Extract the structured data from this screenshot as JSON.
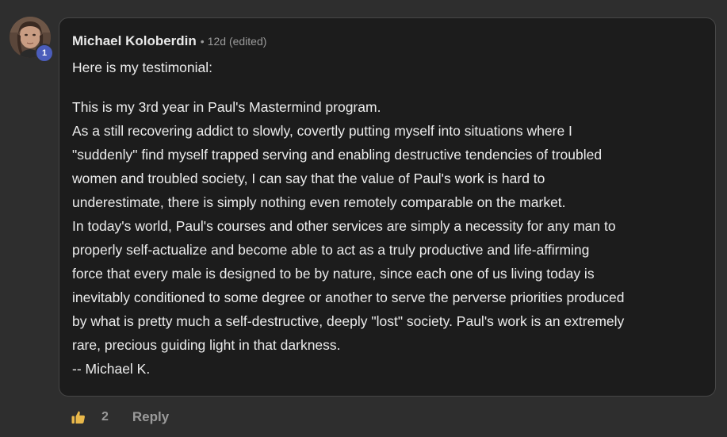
{
  "author": {
    "name": "Michael Koloberdin",
    "level": "1",
    "avatar_icon": "user-avatar-photo"
  },
  "comment": {
    "meta_separator": "•",
    "timestamp": "12d (edited)",
    "intro": "Here is my testimonial:",
    "lines": [
      "This is my 3rd year in Paul's Mastermind program.",
      "As a still recovering addict to slowly, covertly putting myself into situations where I",
      "\"suddenly\" find myself trapped serving and enabling destructive tendencies of troubled",
      "women and troubled society, I can say that the value of Paul's work is hard to",
      "underestimate, there is simply nothing even remotely comparable on the market.",
      "In today's world, Paul's courses and other services are simply a necessity for any man to",
      "properly self-actualize and become able to act as a truly productive and life-affirming",
      "force that every male is designed to be by nature, since each one of us living today is",
      "inevitably conditioned to some degree or another to serve the perverse priorities produced",
      "by what is pretty much a self-destructive, deeply \"lost\" society. Paul's work is an extremely",
      "rare, precious guiding light in that darkness.",
      "-- Michael K."
    ]
  },
  "actions": {
    "like_icon": "thumbs-up-icon",
    "like_count": "2",
    "reply_label": "Reply"
  },
  "colors": {
    "page_background": "#2e2e2e",
    "card_background": "#1c1c1c",
    "card_border": "#474747",
    "level_badge": "#4b5dbb",
    "like_icon": "#e9b84a",
    "muted_text": "#9a9a9a"
  }
}
